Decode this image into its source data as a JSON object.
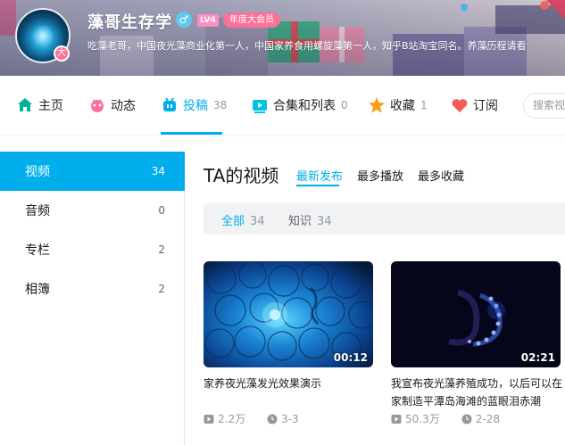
{
  "profile": {
    "username": "藻哥生存学",
    "gender_symbol": "♂",
    "level": "LV4",
    "vip_badge": "年度大会员",
    "avatar_badge": "大",
    "signature": "吃藻老哥，中国夜光藻商业化第一人，中国家养食用螺旋藻第一人，知乎B站淘宝同名。养藻历程请看"
  },
  "nav": {
    "items": [
      {
        "label": "主页",
        "count": "",
        "icon": "home-icon",
        "color": "#00b19d"
      },
      {
        "label": "动态",
        "count": "",
        "icon": "dynamic-icon",
        "color": "#fb7299"
      },
      {
        "label": "投稿",
        "count": "38",
        "icon": "upload-icon",
        "color": "#00aeec"
      },
      {
        "label": "合集和列表",
        "count": "0",
        "icon": "collection-icon",
        "color": "#00c2e5"
      },
      {
        "label": "收藏",
        "count": "1",
        "icon": "star-icon",
        "color": "#ff9b1a"
      },
      {
        "label": "订阅",
        "count": "",
        "icon": "heart-icon",
        "color": "#f55b5b"
      }
    ],
    "search_placeholder": "搜索视"
  },
  "sidebar": {
    "items": [
      {
        "label": "视频",
        "count": "34"
      },
      {
        "label": "音频",
        "count": "0"
      },
      {
        "label": "专栏",
        "count": "2"
      },
      {
        "label": "相簿",
        "count": "2"
      }
    ]
  },
  "main": {
    "title": "TA的视频",
    "tabs": [
      "最新发布",
      "最多播放",
      "最多收藏"
    ],
    "filters": [
      {
        "label": "全部",
        "count": "34"
      },
      {
        "label": "知识",
        "count": "34"
      }
    ],
    "videos": [
      {
        "title": "家养夜光藻发光效果演示",
        "duration": "00:12",
        "plays": "2.2万",
        "date": "3-3"
      },
      {
        "title": "我宣布夜光藻养殖成功，以后可以在家制造平潭岛海滩的蓝眼泪赤潮",
        "duration": "02:21",
        "plays": "50.3万",
        "date": "2-28"
      }
    ]
  },
  "colors": {
    "accent": "#00aeec",
    "pink": "#fb7299"
  }
}
